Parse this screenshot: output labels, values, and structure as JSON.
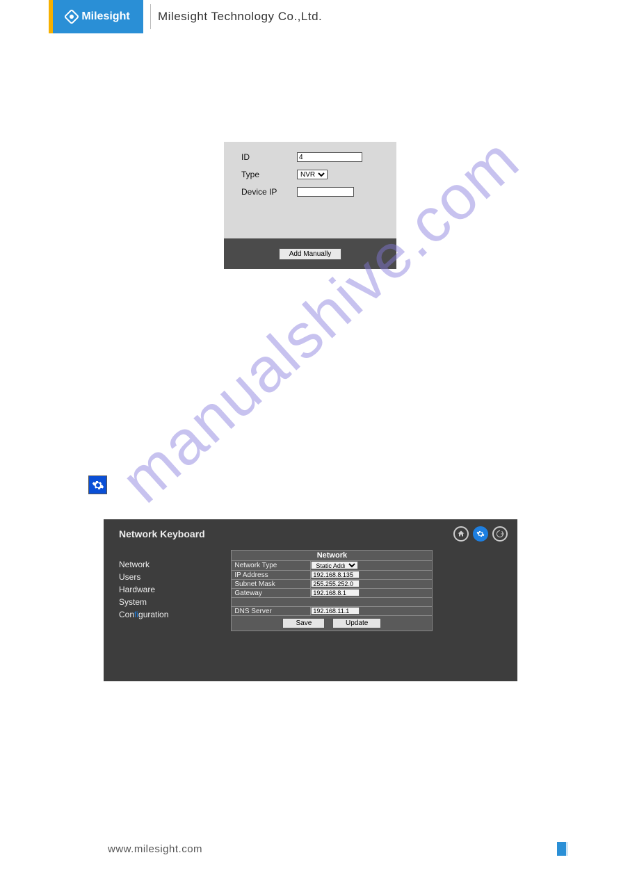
{
  "header": {
    "brand": "Milesight",
    "company": "Milesight Technology Co.,Ltd."
  },
  "watermark": "manualshive.com",
  "add_panel": {
    "fields": {
      "id_label": "ID",
      "id_value": "4",
      "type_label": "Type",
      "type_value": "NVR",
      "device_ip_label": "Device IP",
      "device_ip_value": ""
    },
    "button": "Add Manually"
  },
  "settings_panel": {
    "title": "Network Keyboard",
    "sidebar": {
      "items": [
        "Network",
        "Users",
        "Hardware",
        "System",
        "Configuration"
      ]
    },
    "table": {
      "header": "Network",
      "rows": {
        "network_type": {
          "label": "Network Type",
          "value": "Static Address"
        },
        "ip_address": {
          "label": "IP Address",
          "value": "192.168.8.135"
        },
        "subnet_mask": {
          "label": "Subnet Mask",
          "value": "255.255.252.0"
        },
        "gateway": {
          "label": "Gateway",
          "value": "192.168.8.1"
        },
        "dns_server": {
          "label": "DNS Server",
          "value": "192.168.11.1"
        }
      },
      "buttons": {
        "save": "Save",
        "update": "Update"
      }
    }
  },
  "footer": {
    "url": "www.milesight.com"
  }
}
